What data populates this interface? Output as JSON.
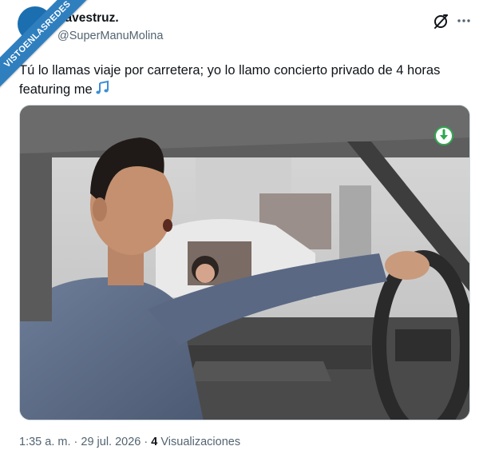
{
  "watermark": {
    "text": "VISTOENLASREDES"
  },
  "author": {
    "display_name": "Yavestruz.",
    "handle": "@SuperManuMolina"
  },
  "tweet": {
    "text": "Tú lo llamas viaje por carretera; yo lo llamo concierto privado de 4 horas featuring me",
    "emoji": "🎶"
  },
  "media": {
    "type": "video-still",
    "badge_icon": "download-arrow-icon"
  },
  "footer": {
    "time": "1:35 a. m.",
    "separator": "·",
    "date": "29 jul. 2026",
    "views_count": "4",
    "views_label": "Visualizaciones"
  },
  "colors": {
    "brand_blue": "#2f7fbf",
    "text_primary": "#0f1419",
    "text_secondary": "#536471",
    "badge_green": "#2fa84f"
  },
  "icons": {
    "grok": "grok-icon",
    "more": "more-dots-icon"
  }
}
